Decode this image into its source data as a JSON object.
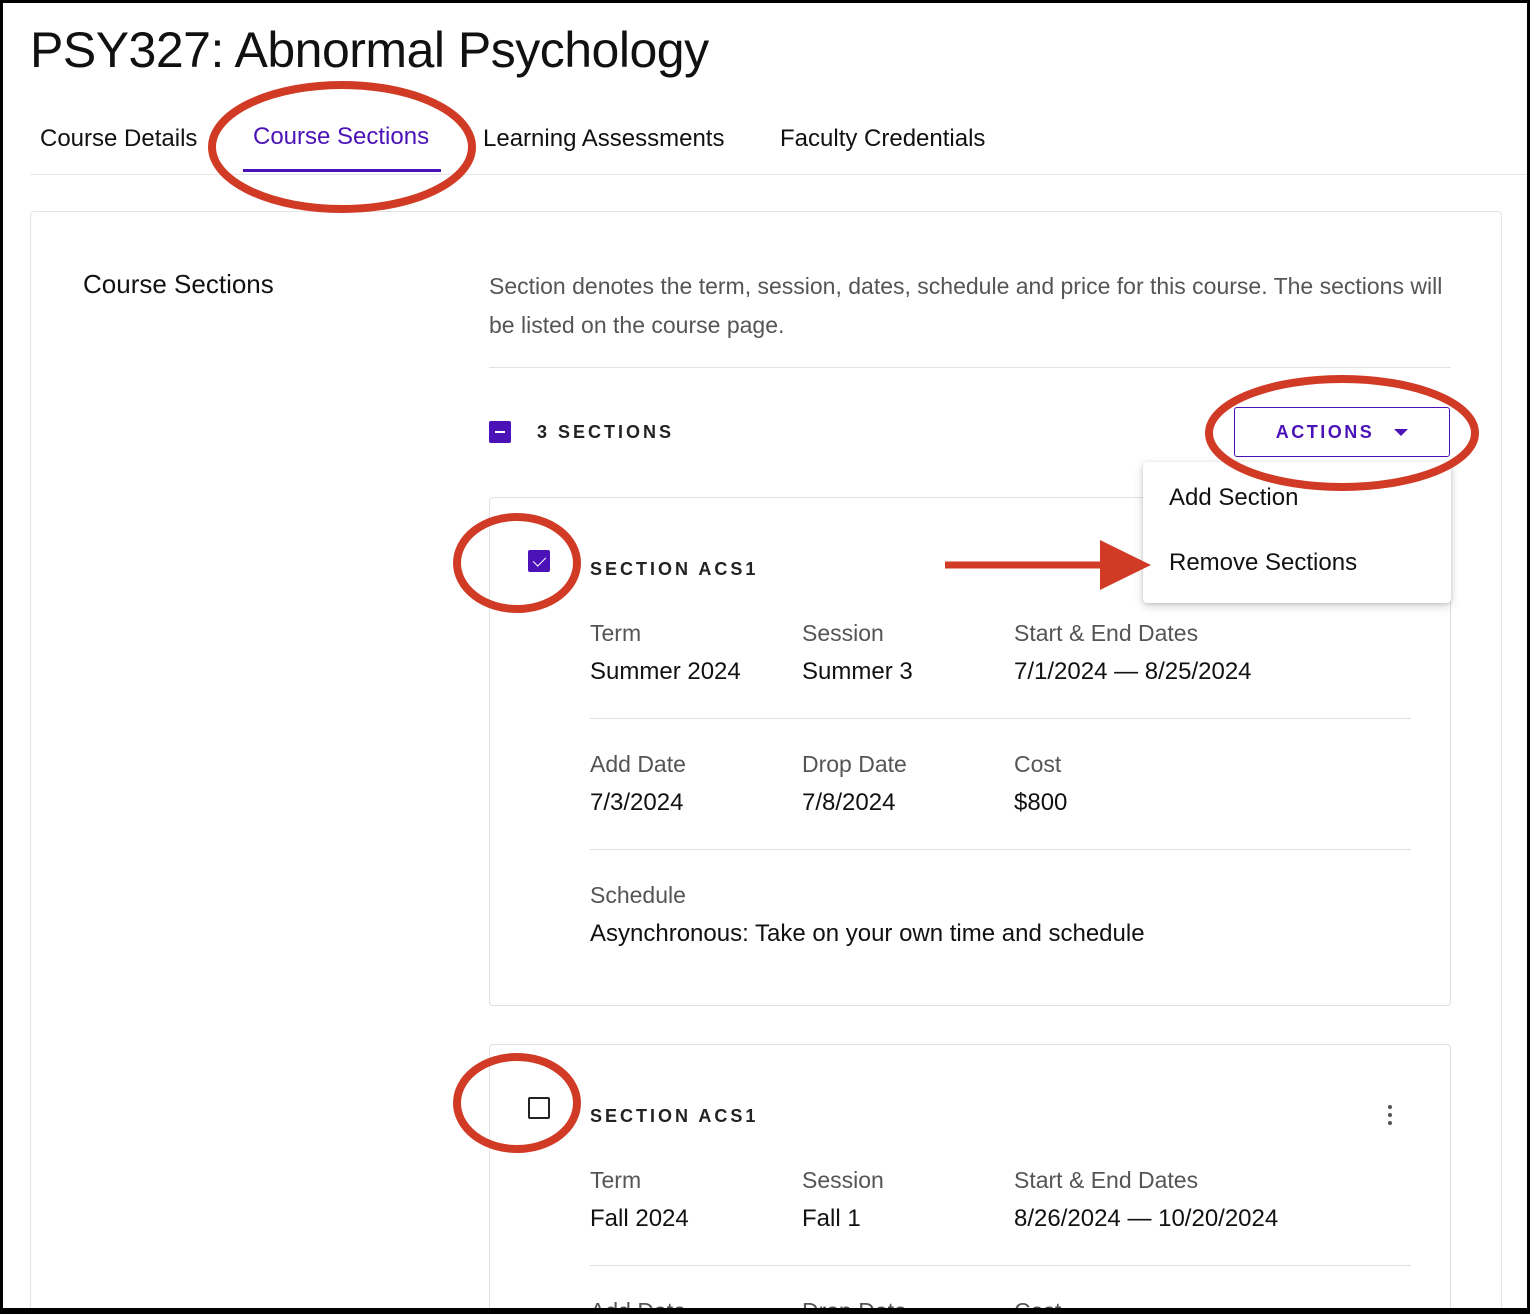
{
  "page": {
    "title": "PSY327: Abnormal Psychology"
  },
  "tabs": [
    {
      "label": "Course Details",
      "active": false
    },
    {
      "label": "Course Sections",
      "active": true
    },
    {
      "label": "Learning Assessments",
      "active": false
    },
    {
      "label": "Faculty Credentials",
      "active": false
    }
  ],
  "course_sections": {
    "heading": "Course Sections",
    "description": "Section denotes the term, session, dates, schedule and price for this course. The sections will be listed on the course page.",
    "count_label": "3 SECTIONS",
    "actions_label": "ACTIONS",
    "actions_menu": [
      {
        "label": "Add Section"
      },
      {
        "label": "Remove Sections"
      }
    ],
    "sections": [
      {
        "title": "SECTION ACS1",
        "checked": true,
        "term_label": "Term",
        "term": "Summer 2024",
        "session_label": "Session",
        "session": "Summer 3",
        "dates_label": "Start & End Dates",
        "dates": "7/1/2024 — 8/25/2024",
        "add_label": "Add Date",
        "add_date": "7/3/2024",
        "drop_label": "Drop Date",
        "drop_date": "7/8/2024",
        "cost_label": "Cost",
        "cost": "$800",
        "schedule_label": "Schedule",
        "schedule": "Asynchronous: Take on your own time and schedule"
      },
      {
        "title": "SECTION ACS1",
        "checked": false,
        "term_label": "Term",
        "term": "Fall 2024",
        "session_label": "Session",
        "session": "Fall 1",
        "dates_label": "Start & End Dates",
        "dates": "8/26/2024 — 10/20/2024",
        "add_label": "Add Date",
        "drop_label": "Drop Date",
        "cost_label": "Cost"
      }
    ]
  },
  "colors": {
    "accent": "#4b12b8",
    "annotation": "#d13a24"
  },
  "icons": {
    "caret": "caret-down-icon",
    "kebab": "more-vertical-icon",
    "arrow": "arrow-right-icon"
  }
}
